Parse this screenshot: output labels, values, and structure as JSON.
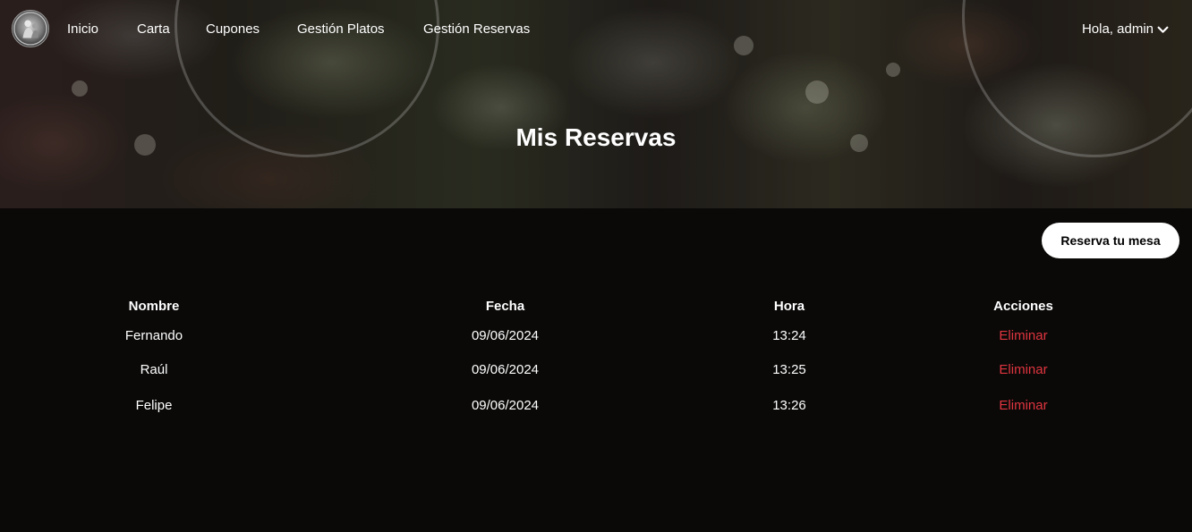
{
  "navbar": {
    "logo_alt": "",
    "links": [
      {
        "label": "Inicio"
      },
      {
        "label": "Carta"
      },
      {
        "label": "Cupones"
      },
      {
        "label": "Gestión Platos"
      },
      {
        "label": "Gestión Reservas"
      }
    ],
    "user_greeting": "Hola, admin"
  },
  "hero": {
    "title": "Mis Reservas"
  },
  "actions": {
    "reserve_button": "Reserva tu mesa"
  },
  "table": {
    "headers": {
      "nombre": "Nombre",
      "fecha": "Fecha",
      "hora": "Hora",
      "acciones": "Acciones"
    },
    "rows": [
      {
        "nombre": "Fernando",
        "fecha": "09/06/2024",
        "hora": "13:24",
        "accion": "Eliminar"
      },
      {
        "nombre": "Raúl",
        "fecha": "09/06/2024",
        "hora": "13:25",
        "accion": "Eliminar"
      },
      {
        "nombre": "Felipe",
        "fecha": "09/06/2024",
        "hora": "13:26",
        "accion": "Eliminar"
      }
    ]
  },
  "colors": {
    "background": "#0a0908",
    "delete_link": "#e0353f",
    "button_bg": "#ffffff"
  }
}
